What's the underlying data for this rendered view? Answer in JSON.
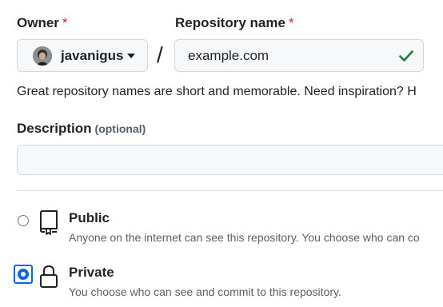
{
  "owner": {
    "label": "Owner",
    "required_mark": "*",
    "selected": "javanigus"
  },
  "separator": "/",
  "repository": {
    "label": "Repository name",
    "required_mark": "*",
    "value": "example.com",
    "valid": true
  },
  "hint": "Great repository names are short and memorable. Need inspiration? H",
  "description": {
    "label": "Description",
    "optional_label": "(optional)",
    "value": ""
  },
  "visibility": [
    {
      "title": "Public",
      "description": "Anyone on the internet can see this repository. You choose who can co",
      "icon": "repo-icon",
      "selected": false
    },
    {
      "title": "Private",
      "description": "You choose who can see and commit to this repository.",
      "icon": "lock-icon",
      "selected": true
    }
  ],
  "colors": {
    "accent": "#0969da",
    "required": "#cf222e",
    "valid": "#1a7f37"
  }
}
